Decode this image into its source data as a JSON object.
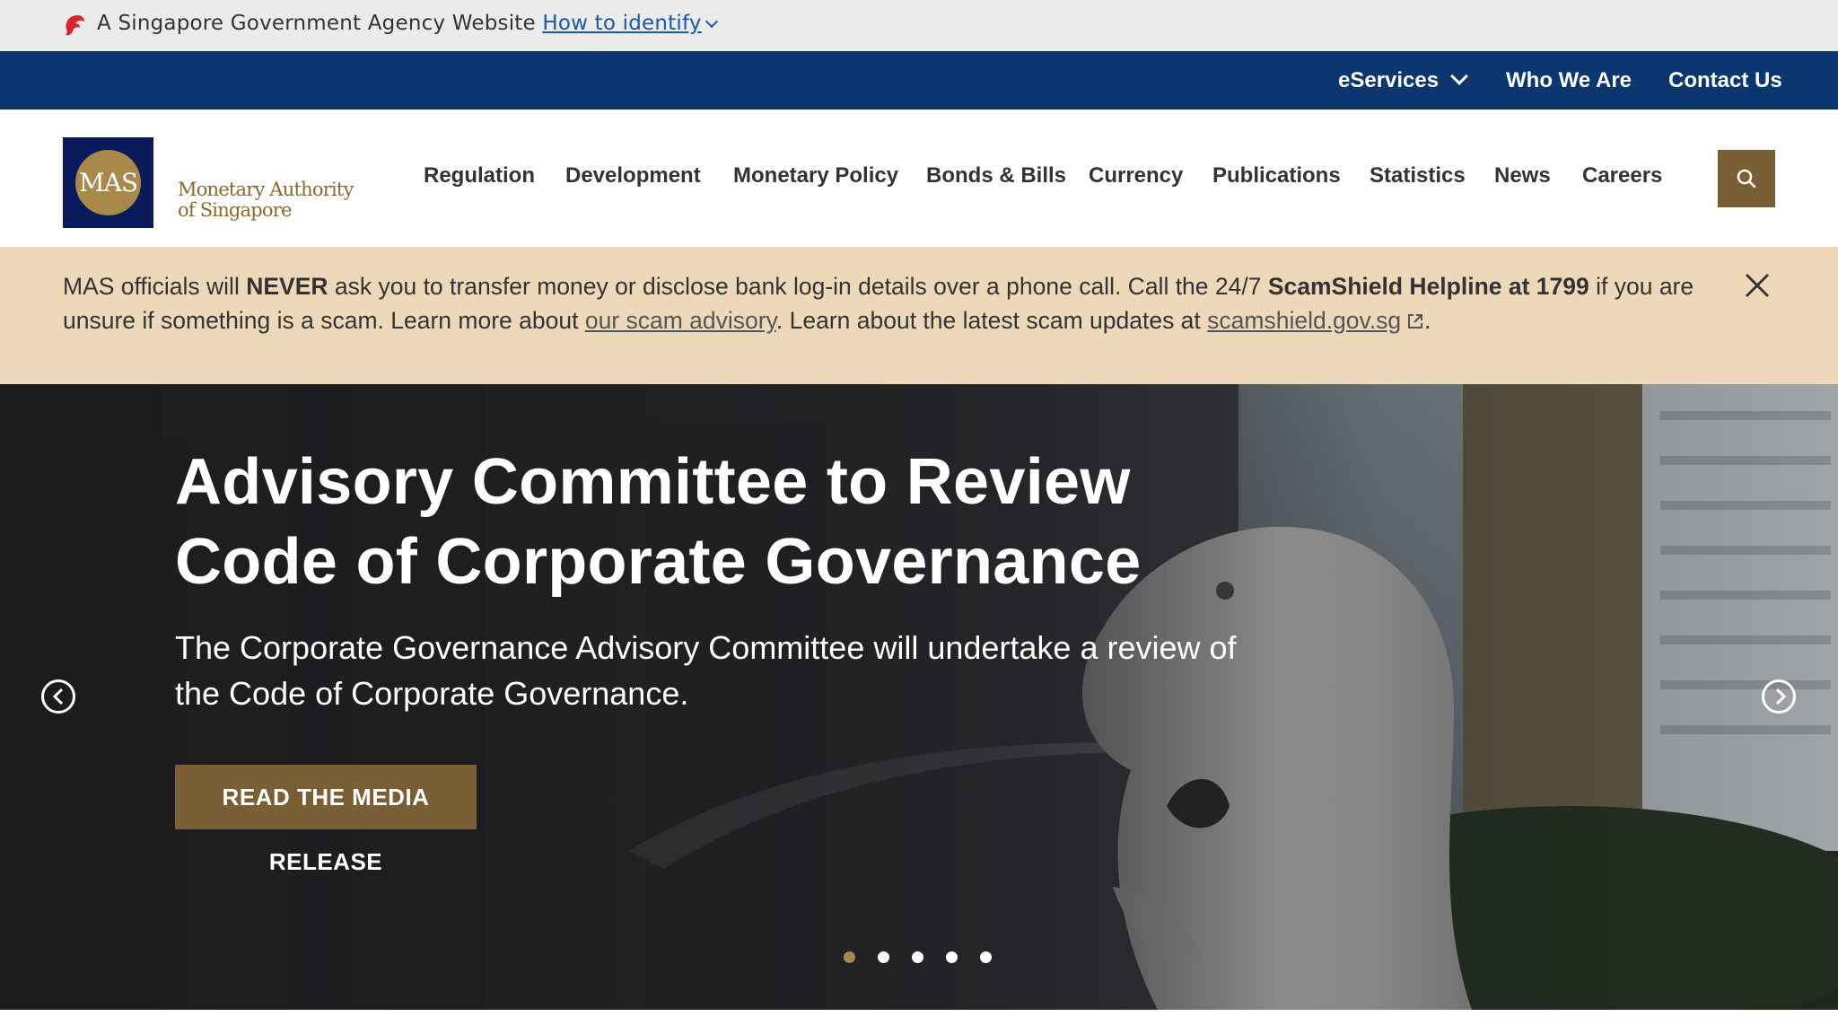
{
  "masthead": {
    "text": "A Singapore Government Agency Website",
    "link": "How to identify"
  },
  "utility_nav": {
    "eservices": "eServices",
    "who_we_are": "Who We Are",
    "contact_us": "Contact Us"
  },
  "logo": {
    "abbr": "MAS",
    "line1": "Monetary Authority",
    "line2": "of Singapore"
  },
  "main_nav": [
    {
      "label": "Regulation"
    },
    {
      "label": "Development"
    },
    {
      "label": "Monetary Policy"
    },
    {
      "label": "Bonds & Bills"
    },
    {
      "label": "Currency"
    },
    {
      "label": "Publications"
    },
    {
      "label": "Statistics"
    },
    {
      "label": "News"
    },
    {
      "label": "Careers"
    }
  ],
  "alert": {
    "p1": "MAS officials will ",
    "never": "NEVER",
    "p2": " ask you to transfer money or disclose bank log-in details over a phone call. Call the 24/7 ",
    "helpline": "ScamShield Helpline at 1799",
    "p3": " if you are unsure if something is a scam. Learn more about ",
    "advisory_link": "our scam advisory",
    "p4": ". Learn about the latest scam updates at ",
    "scamshield_link": "scamshield.gov.sg",
    "p5": "."
  },
  "hero": {
    "title": "Advisory Committee to Review Code of Corporate Governance",
    "subtitle": "The Corporate Governance Advisory Committee will undertake a review of the Code of Corporate Governance.",
    "cta": "READ THE MEDIA RELEASE",
    "slide_count": 5,
    "active_slide": 1
  },
  "colors": {
    "gov_blue": "#0b3670",
    "gold": "#7a5e36",
    "alert_bg": "#eed8ba"
  }
}
